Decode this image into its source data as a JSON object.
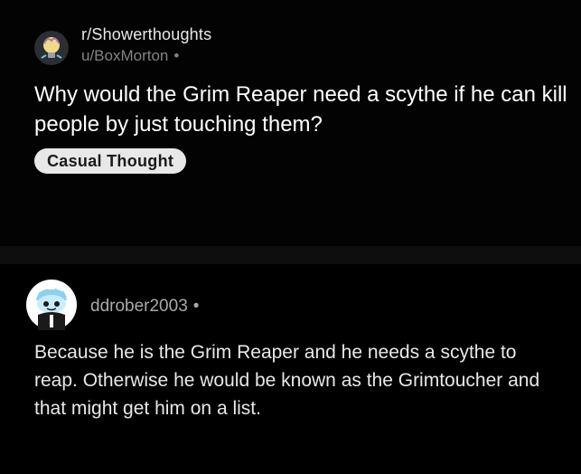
{
  "post": {
    "subreddit": "r/Showerthoughts",
    "author": "u/BoxMorton",
    "separator": "•",
    "title": "Why would the Grim Reaper need a scythe if he can kill people by just touching them?",
    "flair": "Casual Thought",
    "subreddit_icon": "lightbulb-brain-icon"
  },
  "comment": {
    "author": "ddrober2003",
    "separator": "•",
    "body": "Because he is the Grim Reaper and he needs a scythe to reap. Otherwise he would be known as the Grimtoucher and that might get him on a list.",
    "avatar_icon": "snoo-avatar-icon"
  },
  "colors": {
    "background": "#000000",
    "title_text": "#ffffff",
    "muted_text": "#818384",
    "flair_bg": "#e8e8e8",
    "flair_text": "#1a1a1b"
  }
}
